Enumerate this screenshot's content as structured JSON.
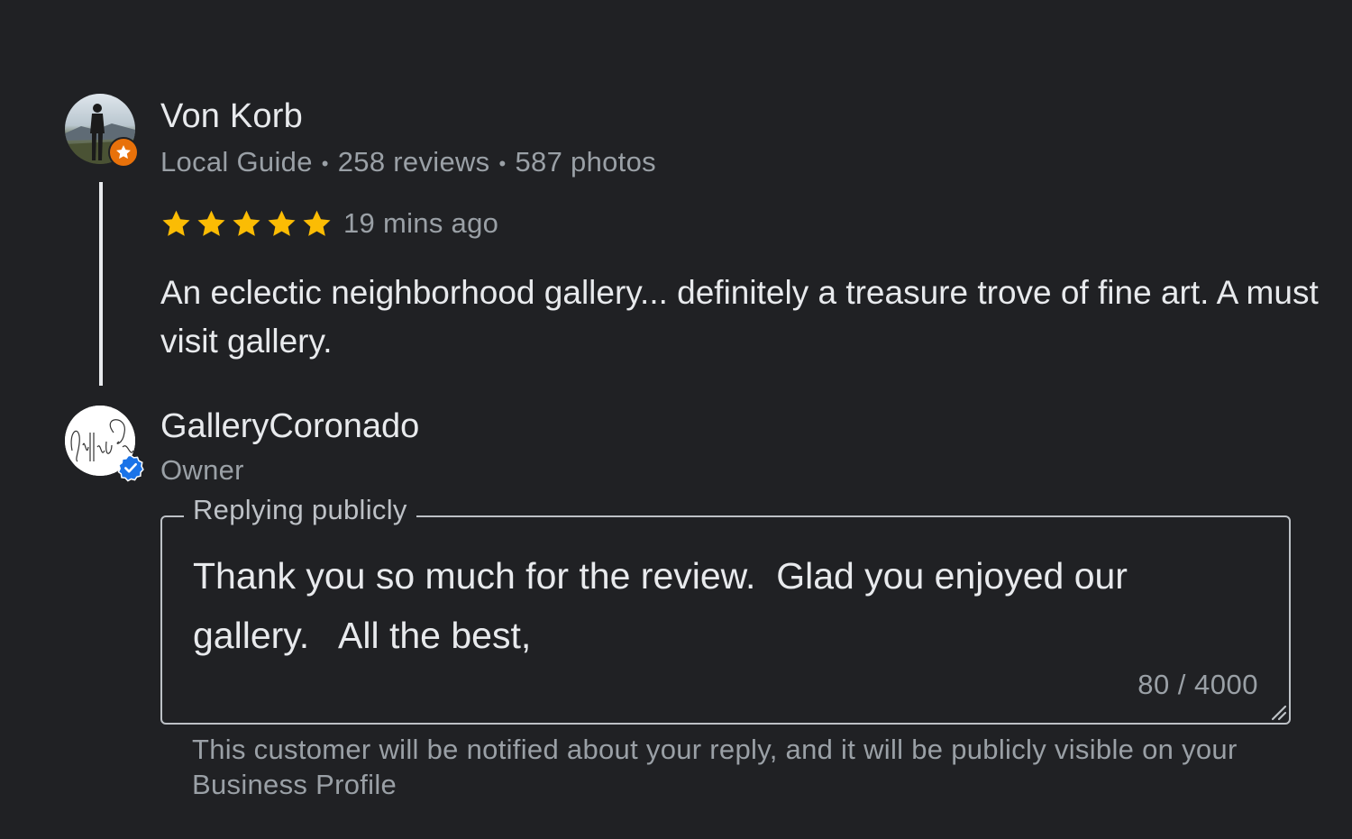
{
  "review": {
    "reviewer_name": "Von Korb",
    "reviewer_role": "Local Guide",
    "review_count": "258 reviews",
    "photo_count": "587 photos",
    "meta_separator": "•",
    "rating": 5,
    "max_rating": 5,
    "time": "19 mins ago",
    "text": "An eclectic neighborhood gallery... definitely a treasure trove of fine art. A must visit gallery."
  },
  "owner": {
    "name": "GalleryCoronado",
    "role": "Owner"
  },
  "reply": {
    "legend": "Replying publicly",
    "value": "Thank you so much for the review.  Glad you enjoyed our gallery.   All the best,",
    "char_count": "80 / 4000",
    "helper_text": "This customer will be notified about your reply, and it will be publicly visible on your Business Profile"
  },
  "colors": {
    "background": "#202124",
    "star": "#fbbc04",
    "local_guide_badge": "#e8710a",
    "verified_badge": "#1a73e8"
  },
  "icons": {
    "reviewer_badge": "local-guide-star-icon",
    "owner_badge": "verified-check-icon",
    "rating": "star-icon",
    "resize": "resize-handle-icon"
  }
}
